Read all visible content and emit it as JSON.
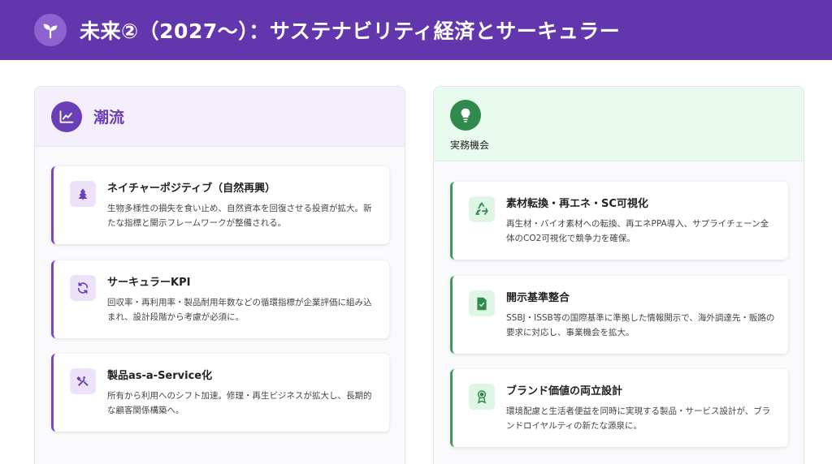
{
  "header": {
    "title": "未来②（2027〜）：サステナビリティ経済とサーキュラー",
    "icon": "sprout-icon",
    "bg_color": "#6236ad"
  },
  "left_panel": {
    "title": "潮流",
    "icon": "chart-line-icon",
    "accent_color": "#6a3fb5",
    "cards": [
      {
        "title": "ネイチャーポジティブ（自然再興）",
        "text": "生物多様性の損失を食い止め、自然資本を回復させる投資が拡大。新たな指標と開示フレームワークが整備される。",
        "icon": "tree-icon"
      },
      {
        "title": "サーキュラーKPI",
        "text": "回収率・再利用率・製品耐用年数などの循環指標が企業評価に組み込まれ、設計段階から考慮が必須に。",
        "icon": "cycle-arrows-icon"
      },
      {
        "title": "製品as-a-Service化",
        "text": "所有から利用へのシフト加速。修理・再生ビジネスが拡大し、長期的な顧客関係構築へ。",
        "icon": "tools-icon"
      }
    ]
  },
  "right_panel": {
    "title": "実務機会",
    "icon": "lightbulb-icon",
    "accent_color": "#2f8a4d",
    "cards": [
      {
        "title": "素材転換・再エネ・SC可視化",
        "text": "再生材・バイオ素材への転換、再エネPPA導入、サプライチェーン全体のCO2可視化で競争力を確保。",
        "icon": "recycle-icon"
      },
      {
        "title": "開示基準整合",
        "text": "SSBJ・ISSB等の国際基準に準拠した情報開示で、海外調達先・販路の要求に対応し、事業機会を拡大。",
        "icon": "document-icon"
      },
      {
        "title": "ブランド価値の両立設計",
        "text": "環境配慮と生活者便益を同時に実現する製品・サービス設計が、ブランドロイヤルティの新たな源泉に。",
        "icon": "award-icon"
      }
    ]
  }
}
